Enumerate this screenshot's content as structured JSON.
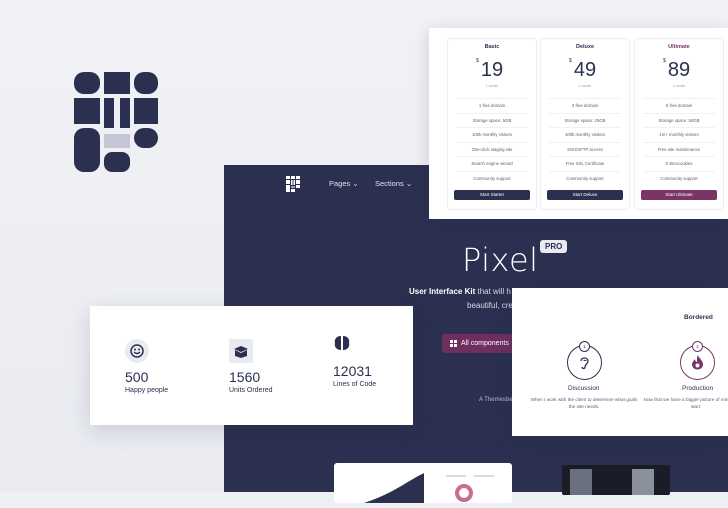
{
  "hero": {
    "nav": [
      "Pages",
      "Sections"
    ],
    "title": "Pixel",
    "badge": "PRO",
    "subtitle_bold": "User Interface Kit",
    "subtitle_rest": "that will h",
    "subtitle_line2": "beautiful, creative a",
    "cta_label": "All components",
    "credit": "A Themesbe"
  },
  "pricing": {
    "plans": [
      {
        "name": "Basic",
        "currency": "$",
        "price": "19",
        "period": "1 month",
        "features": [
          "1 free domain",
          "Storage space: 5GB",
          "100k monthly visitors",
          "One-click staging site",
          "Search engine wizard",
          "Community support"
        ],
        "button": "Start Starter"
      },
      {
        "name": "Deluxe",
        "currency": "$",
        "price": "49",
        "period": "1 month",
        "features": [
          "3 free domain",
          "Storage space: 25GB",
          "400k monthly visitors",
          "SSH/SFTP access",
          "Free SSL Certificate",
          "Community support"
        ],
        "button": "Start Deluxe"
      },
      {
        "name": "Ultimate",
        "currency": "$",
        "price": "89",
        "period": "1 month",
        "features": [
          "5 free domain",
          "Storage space: 50GB",
          "1m+ monthly visitors",
          "Free site maintenance",
          "5 Woocookies",
          "Community support"
        ],
        "button": "Start Ultimate"
      }
    ]
  },
  "stats": [
    {
      "value": "500",
      "label": "Happy people",
      "icon": "smile-icon"
    },
    {
      "value": "1560",
      "label": "Units Ordered",
      "icon": "box-icon"
    },
    {
      "value": "12031",
      "label": "Lines of Code",
      "icon": "brain-icon"
    }
  ],
  "process": {
    "heading": "Bordered",
    "steps": [
      {
        "number": "1",
        "title": "Discussion",
        "desc": "When I work with the client to determine what goals the site needs.",
        "icon": "ear-icon"
      },
      {
        "number": "2",
        "title": "Production",
        "desc": "Now that we have a bigger picture of mind, we can start.",
        "icon": "flame-icon"
      }
    ]
  },
  "colors": {
    "navy": "#2b3050",
    "accent": "#6e2f5e",
    "ultimate": "#7a3566"
  }
}
